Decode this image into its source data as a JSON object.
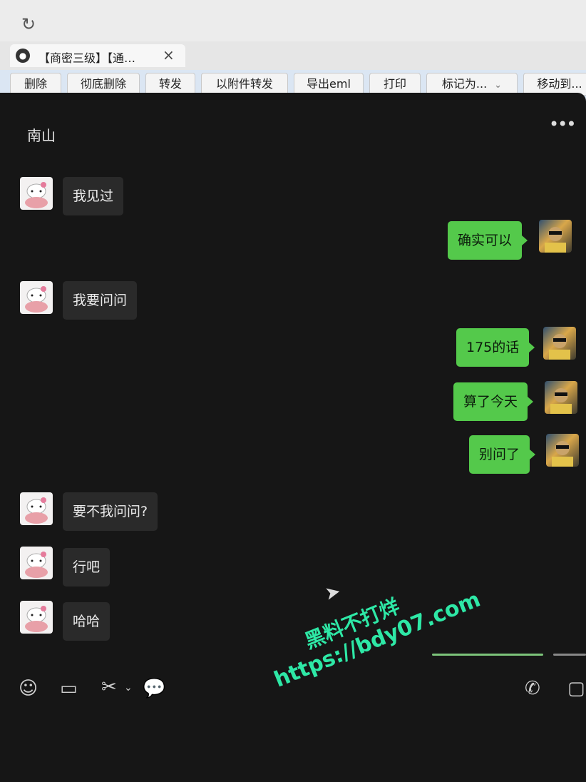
{
  "browser": {
    "tab_title": "【商密三级】【通…",
    "tab_close": "×"
  },
  "toolbar": {
    "buttons": [
      "删除",
      "彻底删除",
      "转发",
      "以附件转发",
      "导出eml",
      "打印",
      "标记为...",
      "移动到..."
    ]
  },
  "chat": {
    "title": "南山",
    "messages": [
      {
        "side": "in",
        "text": "我见过"
      },
      {
        "side": "out",
        "text": "确实可以"
      },
      {
        "side": "in",
        "text": "我要问问"
      },
      {
        "side": "out",
        "text": "175的话"
      },
      {
        "side": "out",
        "text": "算了今天"
      },
      {
        "side": "out",
        "text": "别问了"
      },
      {
        "side": "in",
        "text": "要不我问问?"
      },
      {
        "side": "in",
        "text": "行吧"
      },
      {
        "side": "in",
        "text": "哈哈"
      }
    ]
  },
  "icons": {
    "reload": "reload-icon",
    "more": "more-icon",
    "emoji": "emoji-icon",
    "folder": "folder-icon",
    "scissors": "scissors-icon",
    "chat_history": "chat-history-icon",
    "phone": "phone-icon",
    "video": "video-icon"
  },
  "watermark": {
    "line1": "黑料不打烊",
    "line2": "https://bdy07.com"
  },
  "colors": {
    "chat_bg": "#161616",
    "bubble_in": "#2a2a2a",
    "bubble_out": "#54c94b",
    "watermark": "#2ee8a6"
  }
}
